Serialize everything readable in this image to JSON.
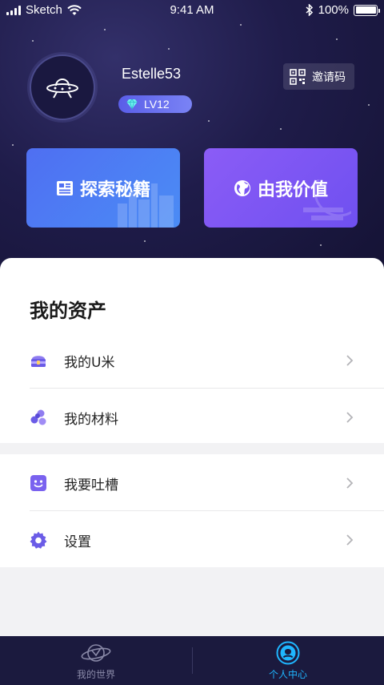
{
  "status_bar": {
    "carrier": "Sketch",
    "time": "9:41 AM",
    "battery": "100%"
  },
  "profile": {
    "username": "Estelle53",
    "level": "LV12",
    "invite_label": "邀请码"
  },
  "cards": {
    "explore": "探索秘籍",
    "value": "由我价值"
  },
  "assets": {
    "title": "我的资产",
    "items": [
      {
        "label": "我的U米",
        "icon": "treasure-box-icon"
      },
      {
        "label": "我的材料",
        "icon": "materials-icon"
      }
    ]
  },
  "more": {
    "items": [
      {
        "label": "我要吐槽",
        "icon": "smile-face-icon"
      },
      {
        "label": "设置",
        "icon": "gear-icon"
      }
    ]
  },
  "tabbar": {
    "world": "我的世界",
    "profile": "个人中心",
    "active_color": "#1fb6ff",
    "inactive_color": "#8a8aa8"
  },
  "colors": {
    "hero_bg": "#1f1c4a",
    "explore_card": "#4f6ff2",
    "value_card": "#7a55f3",
    "accent_icon": "#6b5ce7"
  }
}
